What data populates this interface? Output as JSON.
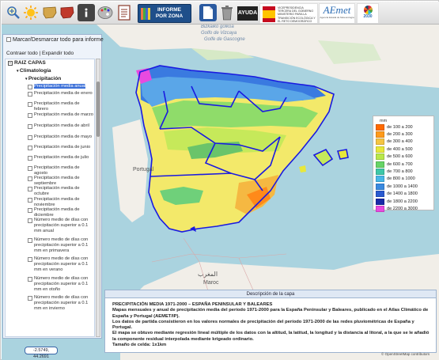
{
  "toolbar": {
    "zona_label_line1": "INFORME",
    "zona_label_line2": "POR ZONA",
    "help_label": "AYUDA",
    "gov_text": "VICEPRESIDENCIA TERCERA DEL GOBIERNO MINISTERIO PARA LA TRANSICIÓN ECOLÓGICA Y EL RETO DEMOGRÁFICO",
    "aemet_logo": "AEmet",
    "aemet_sub": "Agencia Estatal de Meteorología",
    "agenda_label": "2030"
  },
  "panel": {
    "select_all": "Marcar/Desmarcar todo para informe",
    "expand_collapse": "Contraer todo | Expandir todo",
    "root": "RAIZ CAPAS",
    "group": "Climatología",
    "subgroup": "Precipitación",
    "items": [
      "Precipitación media anual",
      "Precipitación media de enero",
      "Precipitación media de febrero",
      "Precipitación media de marzo",
      "Precipitación media de abril",
      "Precipitación media de mayo",
      "Precipitación media de junio",
      "Precipitación media de julio",
      "Precipitación media de agosto",
      "Precipitación media de septiembre",
      "Precipitación media de octubre",
      "Precipitación media de noviembre",
      "Precipitación media de diciembre",
      "Número medio de días con precipitación superior a 0.1 mm anual",
      "Número medio de días con precipitación superior a 0.1 mm en primavera",
      "Número medio de días con precipitación superior a 0.1 mm en verano",
      "Número medio de días con precipitación superior a 0.1 mm en otoño",
      "Número medio de días con precipitación superior a 0.1 mm en invierno"
    ],
    "coordinates": "-2.5749, 44.2691"
  },
  "legend": {
    "unit": "mm",
    "items": [
      {
        "label": "de 100 a 200",
        "color": "#ff6a00"
      },
      {
        "label": "de 200 a 300",
        "color": "#ff9a1a"
      },
      {
        "label": "de 300 a 400",
        "color": "#f5c542"
      },
      {
        "label": "de 400 a 500",
        "color": "#e8e83a"
      },
      {
        "label": "de 500 a 600",
        "color": "#b9e84a"
      },
      {
        "label": "de 600 a 700",
        "color": "#66d466"
      },
      {
        "label": "de 700 a 800",
        "color": "#3ec8a8"
      },
      {
        "label": "de 800 a 1000",
        "color": "#48b8e8"
      },
      {
        "label": "de 1000 a 1400",
        "color": "#3a8ae0"
      },
      {
        "label": "de 1400 a 1800",
        "color": "#2a5ad0"
      },
      {
        "label": "de 1800 a 2200",
        "color": "#1a2aa8"
      },
      {
        "label": "de 2200 a 3000",
        "color": "#e84ae0"
      }
    ]
  },
  "map": {
    "labels": {
      "gulf": "Golfe de Gascogne",
      "gulf_local": "Golfo de Vizcaya",
      "bay": "Bizkaiko golkoa",
      "portugal": "Portugal",
      "morocco": "المغرب",
      "maroc": "Maroc"
    },
    "attribution": "© OpenStreetMap contributors"
  },
  "description": {
    "header": "Descripción de la capa",
    "title": "PRECIPITACIÓN MEDIA 1971-2000 – ESPAÑA PENINSULAR Y BALEARES",
    "p1": "Mapas mensuales y anual de precipitación media del período 1971-2000 para la España Peninsular y Baleares, publicado en el Atlas Climático de España y Portugal (AEMET/IP).",
    "p2": "Los datos de partida consistieron en los valores normales de precipitación del período 1971-2000 de las redes pluviométricas de España y Portugal.",
    "p3": "El mapa se obtuvo mediante regresión lineal múltiple de los datos con la altitud, la latitud, la longitud y la distancia al litoral, a la que se le añadió la componente residual interpolada mediante krigeado ordinario.",
    "p4": "Tamaño de celda: 1x1km"
  }
}
